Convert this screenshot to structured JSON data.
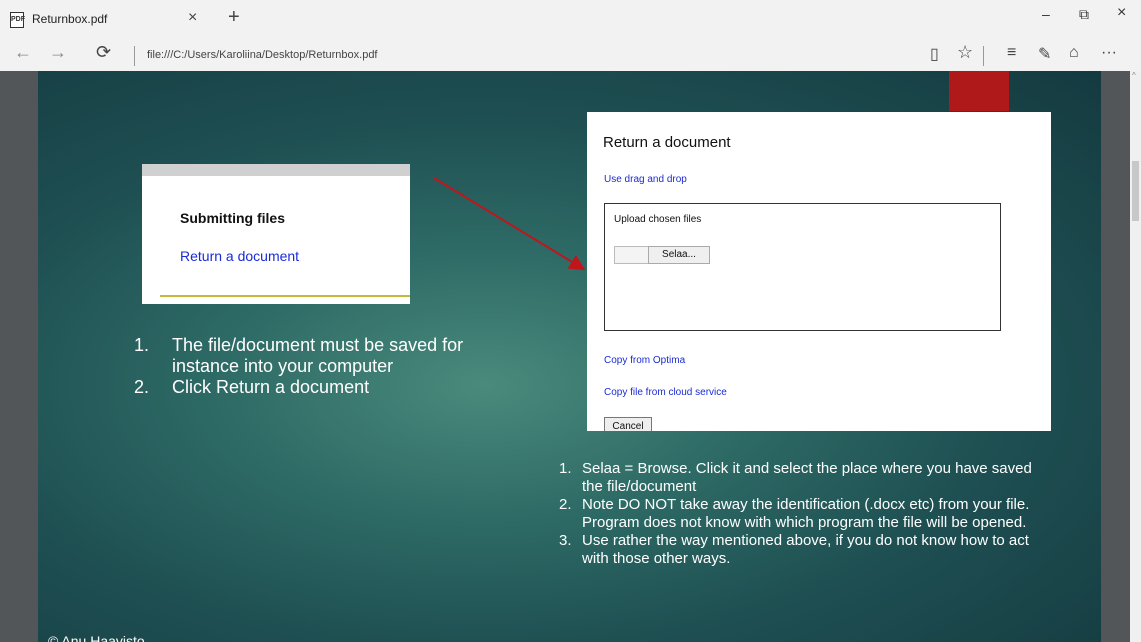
{
  "tab": {
    "title": "Returnbox.pdf",
    "close": "×",
    "new_tab": "+"
  },
  "window": {
    "minimize": "–",
    "restore": "⧉",
    "close": "×"
  },
  "address": {
    "url": "file:///C:/Users/Karoliina/Desktop/Returnbox.pdf"
  },
  "nav": {
    "back": "←",
    "forward": "→",
    "refresh": "⟳"
  },
  "toolbar": {
    "reading": "▯",
    "favorite": "☆",
    "hub": "≡",
    "note": "✎",
    "share": "⌂",
    "more": "···"
  },
  "slide": {
    "card1": {
      "heading": "Submitting files",
      "link": "Return a document"
    },
    "card2": {
      "title": "Return a document",
      "drag_link": "Use drag and drop",
      "upload_label": "Upload chosen files",
      "browse_button": "Selaa...",
      "copy_optima": "Copy from Optima",
      "copy_cloud": "Copy file from cloud service",
      "cancel": "Cancel"
    },
    "list_left": [
      {
        "num": "1.",
        "text": "The file/document must be saved for instance into your computer"
      },
      {
        "num": "2.",
        "text": "Click Return a document"
      }
    ],
    "list_right": [
      {
        "num": "1.",
        "text": "Selaa = Browse. Click it and select the place where you have saved the file/document"
      },
      {
        "num": "2.",
        "text": "Note DO NOT take away the identification (.docx etc) from your file. Program does not know with which program the file will be opened."
      },
      {
        "num": "3.",
        "text": "Use rather the way mentioned above, if you do not know how to act with those other ways."
      }
    ],
    "footer": "© Anu Haavisto"
  },
  "colors": {
    "accent_red": "#b0191a",
    "link_blue": "#1a2bd6",
    "arrow": "#c0161b"
  }
}
